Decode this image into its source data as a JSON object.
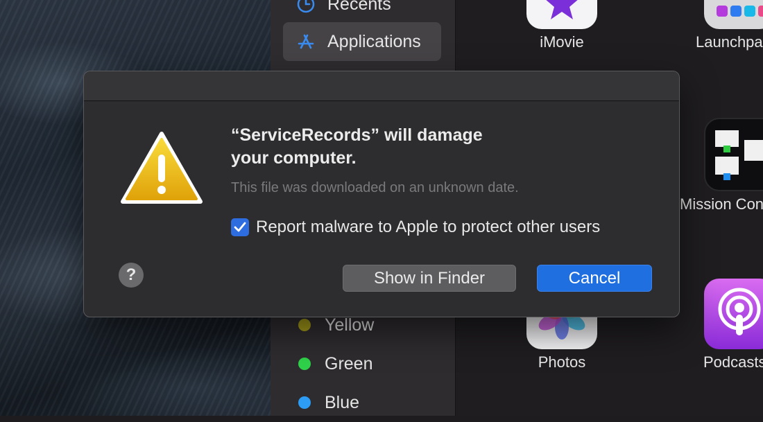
{
  "sidebar": {
    "items": [
      {
        "label": "Recents",
        "icon": "clock-icon"
      },
      {
        "label": "Applications",
        "icon": "applications-icon",
        "selected": true
      }
    ],
    "tags": [
      {
        "label": "Yellow",
        "color": "#a59b1a"
      },
      {
        "label": "Green",
        "color": "#2fd24a"
      },
      {
        "label": "Blue",
        "color": "#2c9cf5"
      }
    ]
  },
  "apps": [
    {
      "name": "iMovie",
      "icon": "imovie-icon"
    },
    {
      "name": "Launchpad",
      "icon": "launchpad-icon"
    },
    {
      "name": "Mission Control",
      "icon": "mission-control-icon"
    },
    {
      "name": "Photos",
      "icon": "photos-icon"
    },
    {
      "name": "Podcasts",
      "icon": "podcasts-icon"
    }
  ],
  "dialog": {
    "title_line1": "“ServiceRecords” will damage",
    "title_line2": "your computer.",
    "subtitle": "This file was downloaded on an unknown date.",
    "checkbox_label": "Report malware to Apple to protect other users",
    "checkbox_checked": true,
    "help_symbol": "?",
    "show_in_finder_label": "Show in Finder",
    "cancel_label": "Cancel",
    "accent_color": "#1f6fe0"
  }
}
